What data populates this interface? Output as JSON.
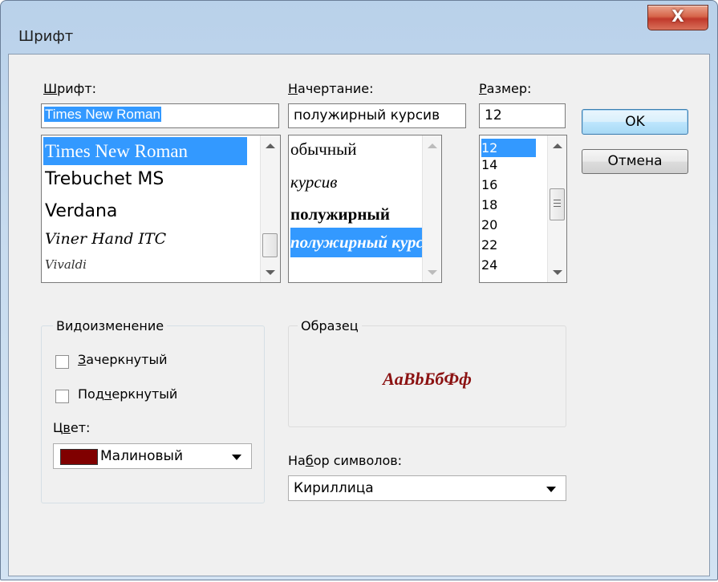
{
  "window": {
    "title": "Шрифт",
    "close_label": "X"
  },
  "font": {
    "label": "Шрифт:",
    "value": "Times New Roman",
    "items": [
      "Times New Roman",
      "Trebuchet MS",
      "Verdana",
      "Viner Hand ITC",
      "Vivaldi"
    ],
    "selected": "Times New Roman"
  },
  "style": {
    "label": "Начертание:",
    "value": "полужирный курсив",
    "items": [
      "обычный",
      "курсив",
      "полужирный",
      "полужирный курсив"
    ],
    "selected": "полужирный курсив"
  },
  "size": {
    "label": "Размер:",
    "value": "12",
    "items": [
      "12",
      "14",
      "16",
      "18",
      "20",
      "22",
      "24"
    ],
    "selected": "12"
  },
  "buttons": {
    "ok": "OK",
    "cancel": "Отмена"
  },
  "effects": {
    "title": "Видоизменение",
    "strikeout": {
      "label": "Зачеркнутый",
      "checked": false
    },
    "underline": {
      "label": "Подчеркнутый",
      "checked": false
    },
    "color_label": "Цвет:",
    "color_value": "Малиновый",
    "color_hex": "#800000"
  },
  "sample": {
    "title": "Образец",
    "text": "AaBbБбФф",
    "color": "#8b1111"
  },
  "charset": {
    "label": "Набор символов:",
    "value": "Кириллица"
  },
  "colors": {
    "selection": "#3399ff",
    "default_button_border": "#3c7fb1"
  }
}
